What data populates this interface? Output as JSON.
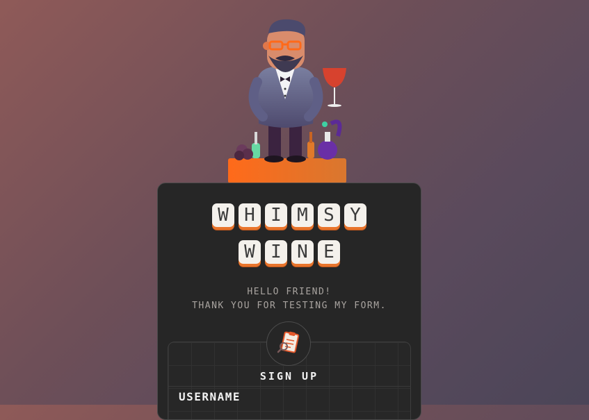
{
  "mascot": {
    "description_icon": "sommelier-mascot-icon"
  },
  "title": {
    "row1": [
      "W",
      "H",
      "I",
      "M",
      "S",
      "Y"
    ],
    "row2": [
      "W",
      "I",
      "N",
      "E"
    ]
  },
  "greeting": {
    "line1": "HELLO FRIEND!",
    "line2": "THANK YOU FOR TESTING MY FORM."
  },
  "form": {
    "badge_icon": "clipboard-magnifier-icon",
    "heading": "SIGN UP",
    "username_label": "USERNAME"
  },
  "colors": {
    "card_bg": "#262626",
    "key_face": "#f4f1ec",
    "key_accent": "#e8742b",
    "pedestal": "#f07a2a"
  }
}
